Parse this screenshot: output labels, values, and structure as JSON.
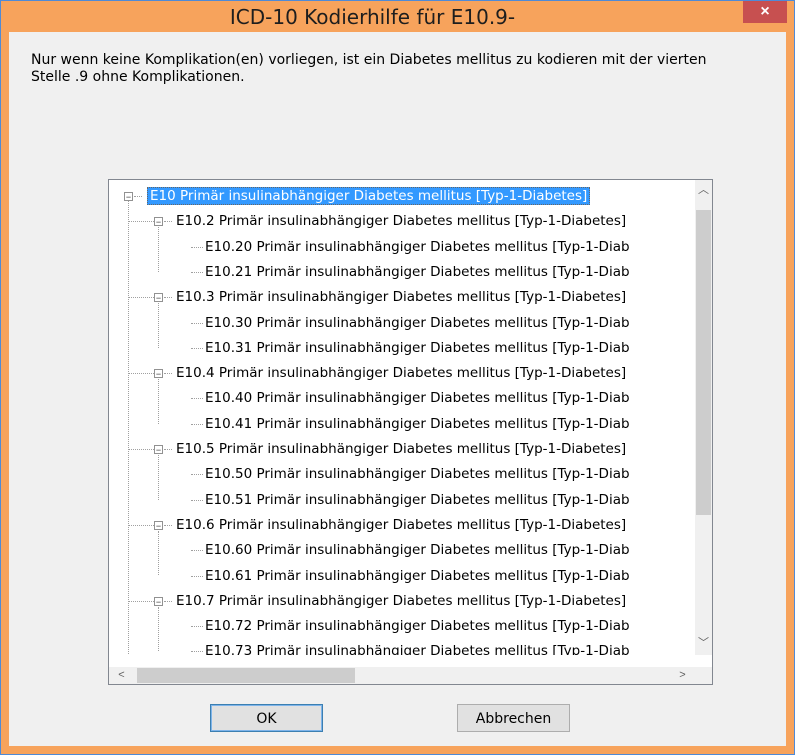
{
  "window": {
    "title": "ICD-10 Kodierhilfe für E10.9-",
    "close_label": "×"
  },
  "description": "Nur wenn keine Komplikation(en) vorliegen, ist ein Diabetes mellitus zu kodieren mit der vierten Stelle .9 ohne Komplikationen.",
  "tree": {
    "items": [
      {
        "label": "E10 Primär insulinabhängiger Diabetes mellitus [Typ-1-Diabetes]",
        "level": 0,
        "expander": "−",
        "selected": true
      },
      {
        "label": "E10.2 Primär insulinabhängiger Diabetes mellitus [Typ-1-Diabetes]",
        "level": 1,
        "expander": "−"
      },
      {
        "label": "E10.20 Primär insulinabhängiger Diabetes mellitus [Typ-1-Diab",
        "level": 2
      },
      {
        "label": "E10.21 Primär insulinabhängiger Diabetes mellitus [Typ-1-Diab",
        "level": 2
      },
      {
        "label": "E10.3 Primär insulinabhängiger Diabetes mellitus [Typ-1-Diabetes]",
        "level": 1,
        "expander": "−"
      },
      {
        "label": "E10.30 Primär insulinabhängiger Diabetes mellitus [Typ-1-Diab",
        "level": 2
      },
      {
        "label": "E10.31 Primär insulinabhängiger Diabetes mellitus [Typ-1-Diab",
        "level": 2
      },
      {
        "label": "E10.4 Primär insulinabhängiger Diabetes mellitus [Typ-1-Diabetes]",
        "level": 1,
        "expander": "−"
      },
      {
        "label": "E10.40 Primär insulinabhängiger Diabetes mellitus [Typ-1-Diab",
        "level": 2
      },
      {
        "label": "E10.41 Primär insulinabhängiger Diabetes mellitus [Typ-1-Diab",
        "level": 2
      },
      {
        "label": "E10.5 Primär insulinabhängiger Diabetes mellitus [Typ-1-Diabetes]",
        "level": 1,
        "expander": "−"
      },
      {
        "label": "E10.50 Primär insulinabhängiger Diabetes mellitus [Typ-1-Diab",
        "level": 2
      },
      {
        "label": "E10.51 Primär insulinabhängiger Diabetes mellitus [Typ-1-Diab",
        "level": 2
      },
      {
        "label": "E10.6 Primär insulinabhängiger Diabetes mellitus [Typ-1-Diabetes]",
        "level": 1,
        "expander": "−"
      },
      {
        "label": "E10.60 Primär insulinabhängiger Diabetes mellitus [Typ-1-Diab",
        "level": 2
      },
      {
        "label": "E10.61 Primär insulinabhängiger Diabetes mellitus [Typ-1-Diab",
        "level": 2
      },
      {
        "label": "E10.7 Primär insulinabhängiger Diabetes mellitus [Typ-1-Diabetes]",
        "level": 1,
        "expander": "−"
      },
      {
        "label": "E10.72 Primär insulinabhängiger Diabetes mellitus [Typ-1-Diab",
        "level": 2
      },
      {
        "label": "E10.73 Primär insulinabhängiger Diabetes mellitus [Typ-1-Diab",
        "level": 2
      }
    ],
    "scroll_up_icon": "chevron-up-icon",
    "scroll_down_icon": "chevron-down-icon",
    "scroll_left_icon": "chevron-left-icon",
    "scroll_right_icon": "chevron-right-icon",
    "up_glyph": "︿",
    "down_glyph": "﹀",
    "left_glyph": "<",
    "right_glyph": ">"
  },
  "buttons": {
    "ok": "OK",
    "cancel": "Abbrechen"
  },
  "colors": {
    "titlebar": "#f7a35c",
    "close": "#c75050",
    "selection": "#3399ff"
  }
}
